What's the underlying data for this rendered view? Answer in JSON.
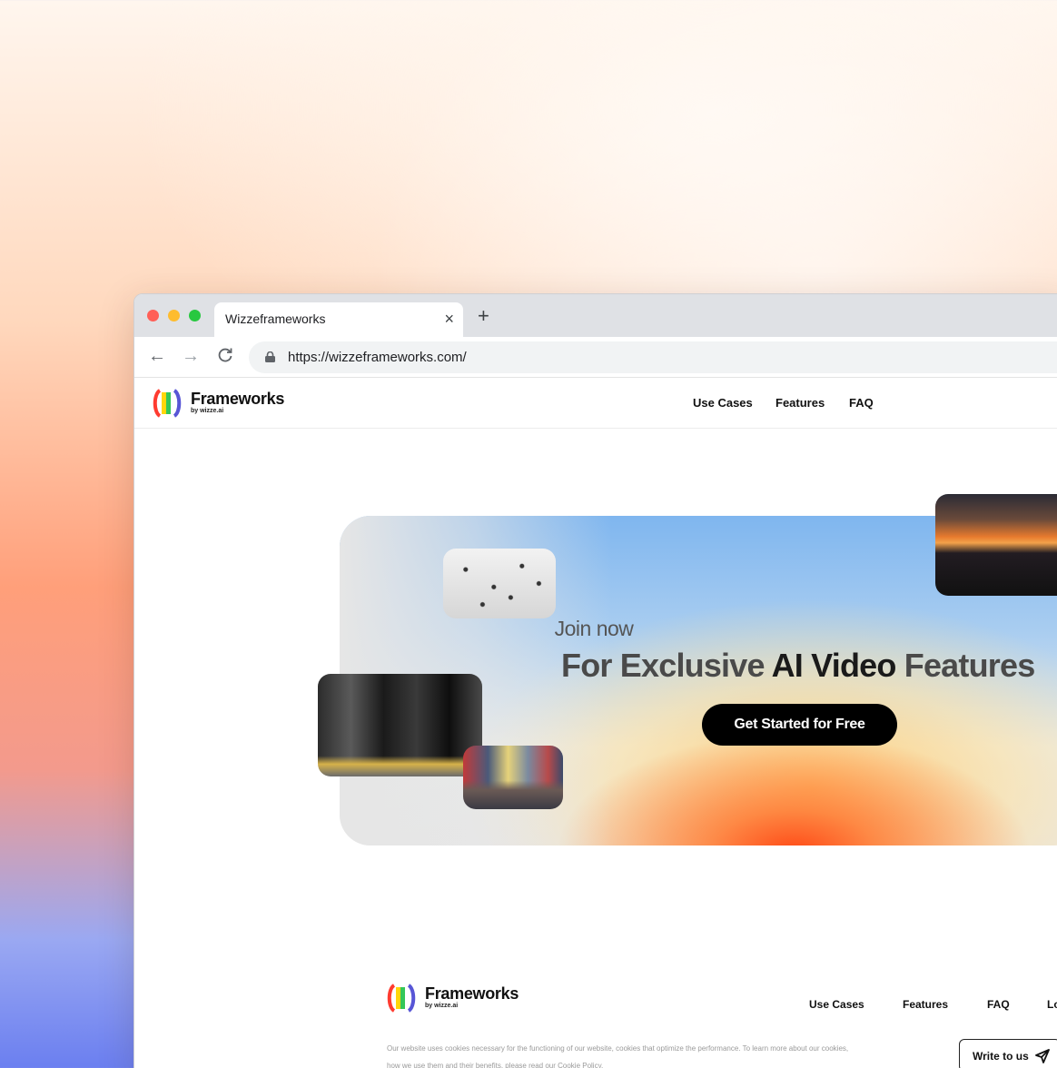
{
  "browser": {
    "tab_title": "Wizzeframeworks",
    "tab_close": "×",
    "new_tab": "+",
    "back": "←",
    "forward": "→",
    "reload": "C",
    "url": "https://wizzeframeworks.com/"
  },
  "header": {
    "brand_name": "Frameworks",
    "brand_sub": "by wizze.ai",
    "nav": [
      "Use Cases",
      "Features",
      "FAQ"
    ]
  },
  "hero": {
    "join": "Join now",
    "headline_prefix": "For Exclusive ",
    "headline_emphasis": "AI Video",
    "headline_suffix": " Features",
    "cta": "Get Started for Free"
  },
  "footer": {
    "brand_name": "Frameworks",
    "brand_sub": "by wizze.ai",
    "nav": [
      "Use Cases",
      "Features",
      "FAQ",
      "Lo"
    ],
    "cookie_line1": "Our website uses cookies necessary for the functioning of our website, cookies that optimize the performance. To learn more about our cookies,",
    "cookie_line2": "how we use them and their benefits, please read our Cookie Policy.",
    "write_label": "Write to us"
  },
  "colors": {
    "cta_bg": "#000000",
    "accent_orange": "#ff4a16",
    "accent_blue": "#7fb6ef"
  }
}
